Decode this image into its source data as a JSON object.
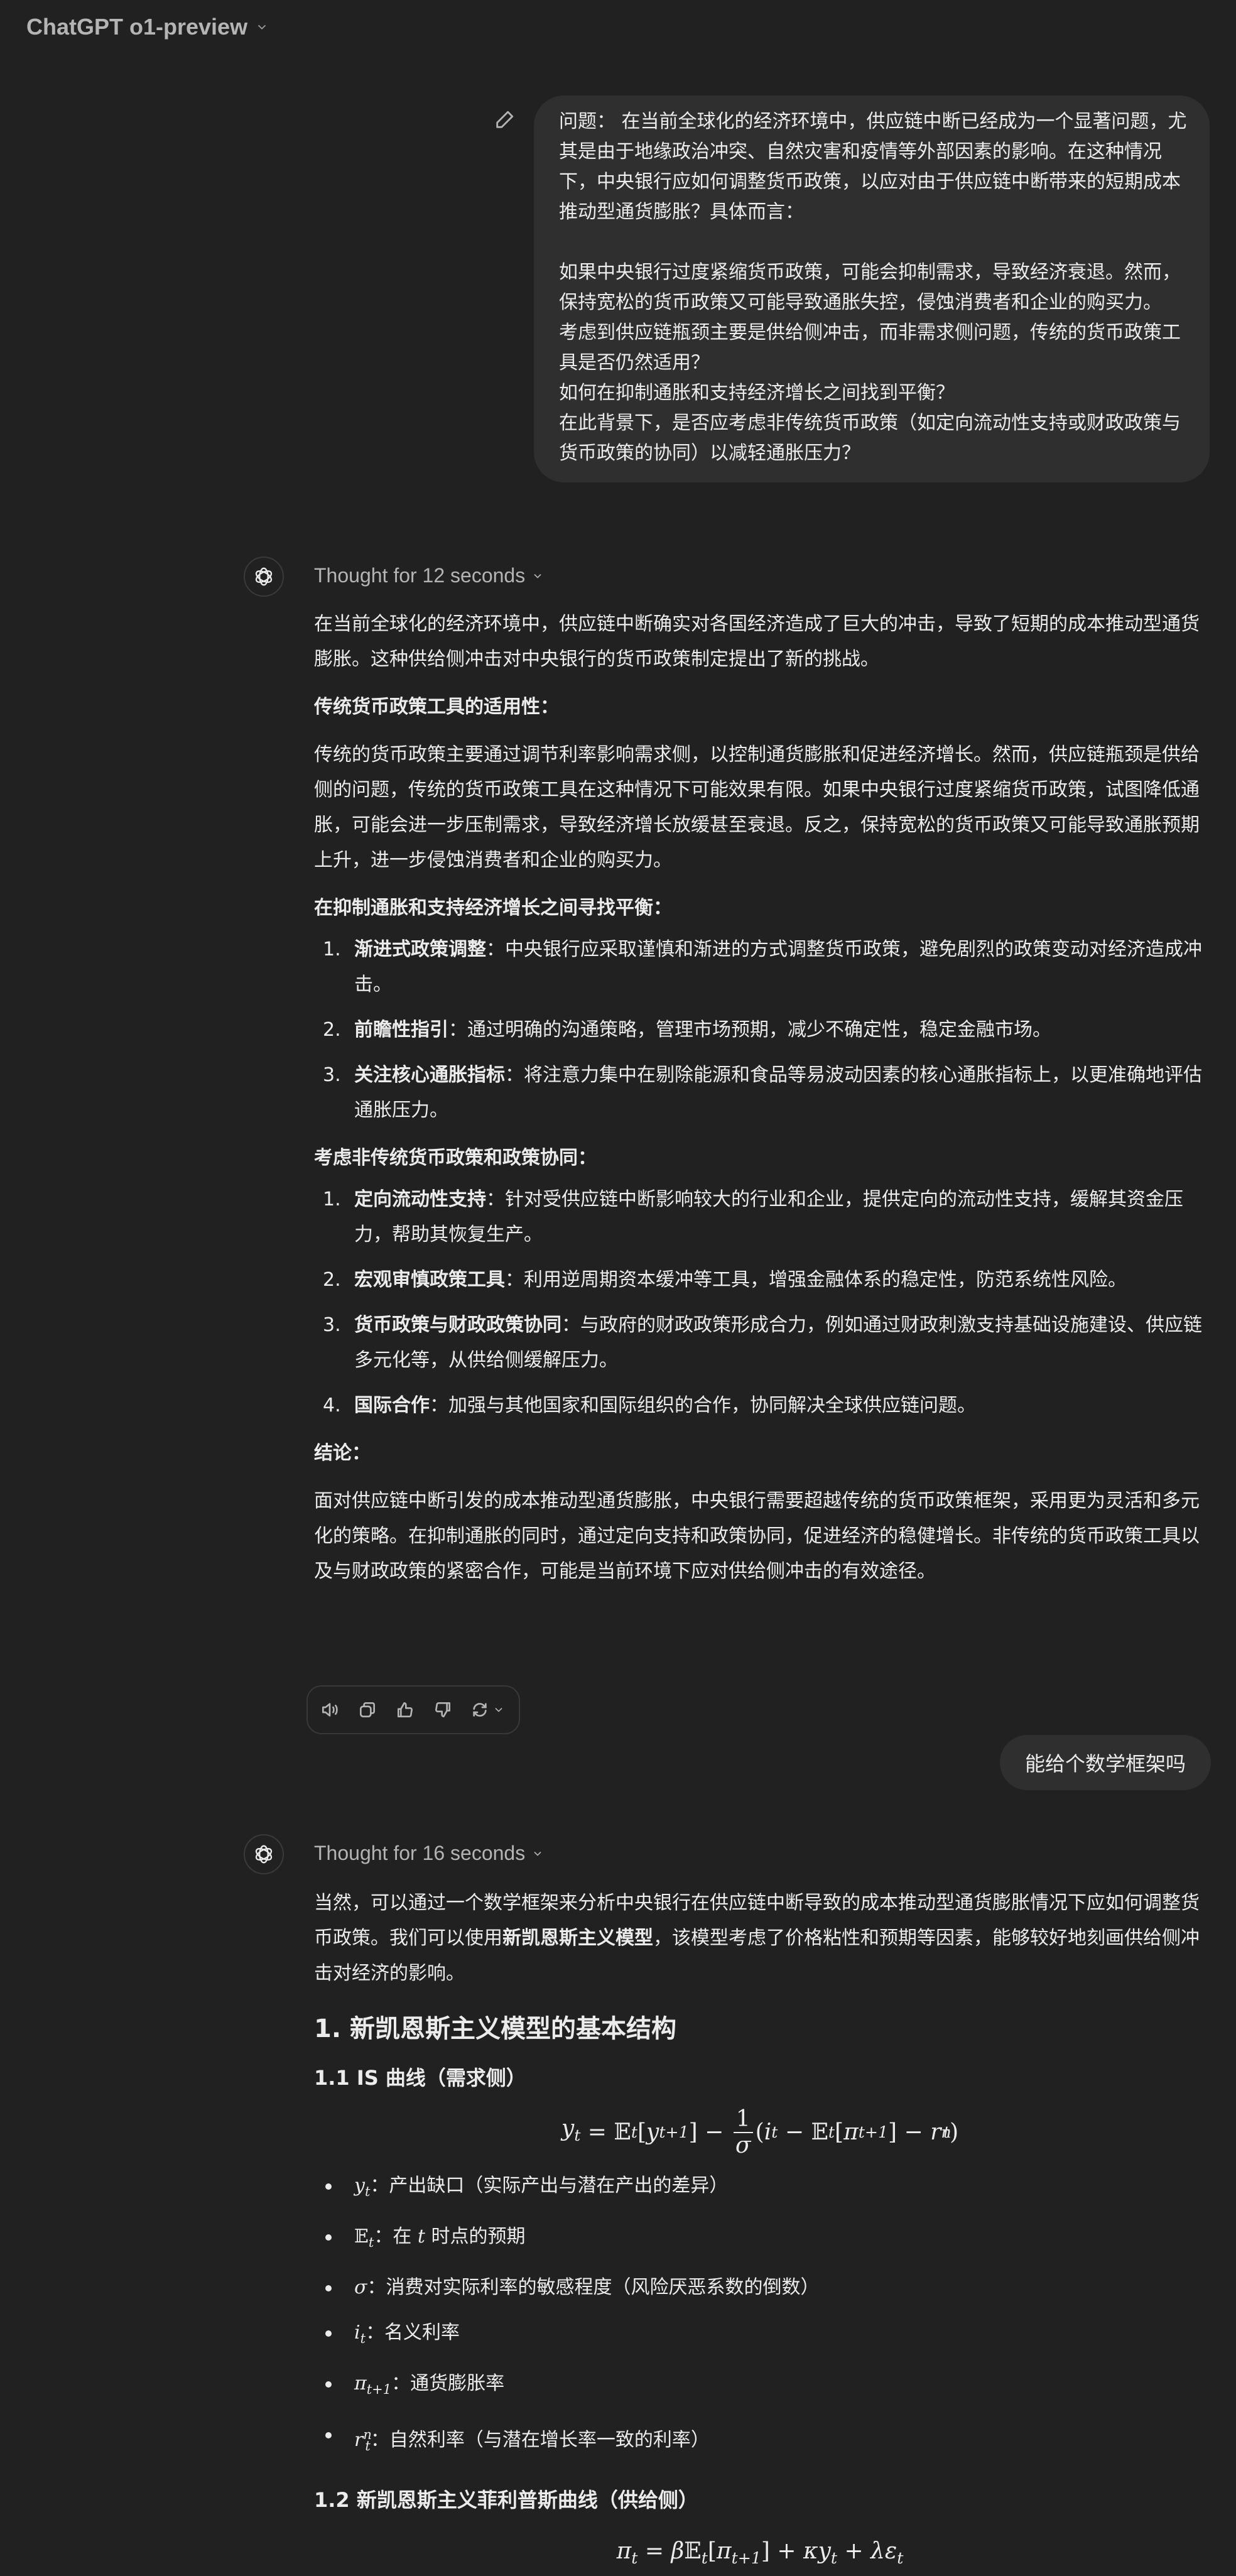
{
  "header": {
    "title": "ChatGPT o1-preview",
    "model_menu_icon": "chevron-down-icon"
  },
  "conversation": {
    "user_message_1": {
      "edit_icon": "pencil-icon",
      "paragraphs": [
        "问题： 在当前全球化的经济环境中，供应链中断已经成为一个显著问题，尤其是由于地缘政治冲突、自然灾害和疫情等外部因素的影响。在这种情况下，中央银行应如何调整货币政策，以应对由于供应链中断带来的短期成本推动型通货膨胀？具体而言：",
        "",
        "如果中央银行过度紧缩货币政策，可能会抑制需求，导致经济衰退。然而，保持宽松的货币政策又可能导致通胀失控，侵蚀消费者和企业的购买力。",
        "考虑到供应链瓶颈主要是供给侧冲击，而非需求侧问题，传统的货币政策工具是否仍然适用？",
        "如何在抑制通胀和支持经济增长之间找到平衡？",
        "在此背景下，是否应考虑非传统货币政策（如定向流动性支持或财政政策与货币政策的协同）以减轻通胀压力？"
      ]
    },
    "assistant_message_1": {
      "thought_label": "Thought for 12 seconds",
      "intro": "在当前全球化的经济环境中，供应链中断确实对各国经济造成了巨大的冲击，导致了短期的成本推动型通货膨胀。这种供给侧冲击对中央银行的货币政策制定提出了新的挑战。",
      "section1_heading": "传统货币政策工具的适用性：",
      "section1_body": "传统的货币政策主要通过调节利率影响需求侧，以控制通货膨胀和促进经济增长。然而，供应链瓶颈是供给侧的问题，传统的货币政策工具在这种情况下可能效果有限。如果中央银行过度紧缩货币政策，试图降低通胀，可能会进一步压制需求，导致经济增长放缓甚至衰退。反之，保持宽松的货币政策又可能导致通胀预期上升，进一步侵蚀消费者和企业的购买力。",
      "section2_heading": "在抑制通胀和支持经济增长之间寻找平衡：",
      "section2_items": [
        {
          "num": "1.",
          "bold": "渐进式政策调整",
          "text": "：中央银行应采取谨慎和渐进的方式调整货币政策，避免剧烈的政策变动对经济造成冲击。"
        },
        {
          "num": "2.",
          "bold": "前瞻性指引",
          "text": "：通过明确的沟通策略，管理市场预期，减少不确定性，稳定金融市场。"
        },
        {
          "num": "3.",
          "bold": "关注核心通胀指标",
          "text": "：将注意力集中在剔除能源和食品等易波动因素的核心通胀指标上，以更准确地评估通胀压力。"
        }
      ],
      "section3_heading": "考虑非传统货币政策和政策协同：",
      "section3_items": [
        {
          "num": "1.",
          "bold": "定向流动性支持",
          "text": "：针对受供应链中断影响较大的行业和企业，提供定向的流动性支持，缓解其资金压力，帮助其恢复生产。"
        },
        {
          "num": "2.",
          "bold": "宏观审慎政策工具",
          "text": "：利用逆周期资本缓冲等工具，增强金融体系的稳定性，防范系统性风险。"
        },
        {
          "num": "3.",
          "bold": "货币政策与财政政策协同",
          "text": "：与政府的财政政策形成合力，例如通过财政刺激支持基础设施建设、供应链多元化等，从供给侧缓解压力。"
        },
        {
          "num": "4.",
          "bold": "国际合作",
          "text": "：加强与其他国家和国际组织的合作，协同解决全球供应链问题。"
        }
      ],
      "conclusion_heading": "结论：",
      "conclusion_body": "面对供应链中断引发的成本推动型通货膨胀，中央银行需要超越传统的货币政策框架，采用更为灵活和多元化的策略。在抑制通胀的同时，通过定向支持和政策协同，促进经济的稳健增长。非传统的货币政策工具以及与财政政策的紧密合作，可能是当前环境下应对供给侧冲击的有效途径。",
      "action_icons": [
        "speaker-icon",
        "copy-icon",
        "thumbs-up-icon",
        "thumbs-down-icon",
        "regenerate-icon"
      ]
    },
    "user_message_2": {
      "text": "能给个数学框架吗"
    },
    "assistant_message_2": {
      "thought_label": "Thought for 16 seconds",
      "intro_before": "当然，可以通过一个数学框架来分析中央银行在供应链中断导致的成本推动型通货膨胀情况下应如何调整货币政策。我们可以使用",
      "intro_bold": "新凯恩斯主义模型",
      "intro_after": "，该模型考虑了价格粘性和预期等因素，能够较好地刻画供给侧冲击对经济的影响。",
      "h2": "1. 新凯恩斯主义模型的基本结构",
      "h3_1": "1.1 IS 曲线（需求侧）",
      "is_equation": "y_t = E_t[y_{t+1}] − (1/σ)(i_t − E_t[π_{t+1}] − r_t^n)",
      "variables": [
        {
          "symbol": "y_t",
          "desc": "：产出缺口（实际产出与潜在产出的差异）"
        },
        {
          "symbol": "E_t",
          "desc_before": "：在 ",
          "desc_math": "t",
          "desc": " 时点的预期"
        },
        {
          "symbol": "σ",
          "desc": "：消费对实际利率的敏感程度（风险厌恶系数的倒数）"
        },
        {
          "symbol": "i_t",
          "desc": "：名义利率"
        },
        {
          "symbol": "π_{t+1}",
          "desc": "：通货膨胀率"
        },
        {
          "symbol": "r_t^n",
          "desc": "：自然利率（与潜在增长率一致的利率）"
        }
      ],
      "h3_2": "1.2 新凯恩斯主义菲利普斯曲线（供给侧）",
      "nkpc_equation": "π_t = βE_t[π_{t+1}] + κy_t + λε_t"
    }
  }
}
